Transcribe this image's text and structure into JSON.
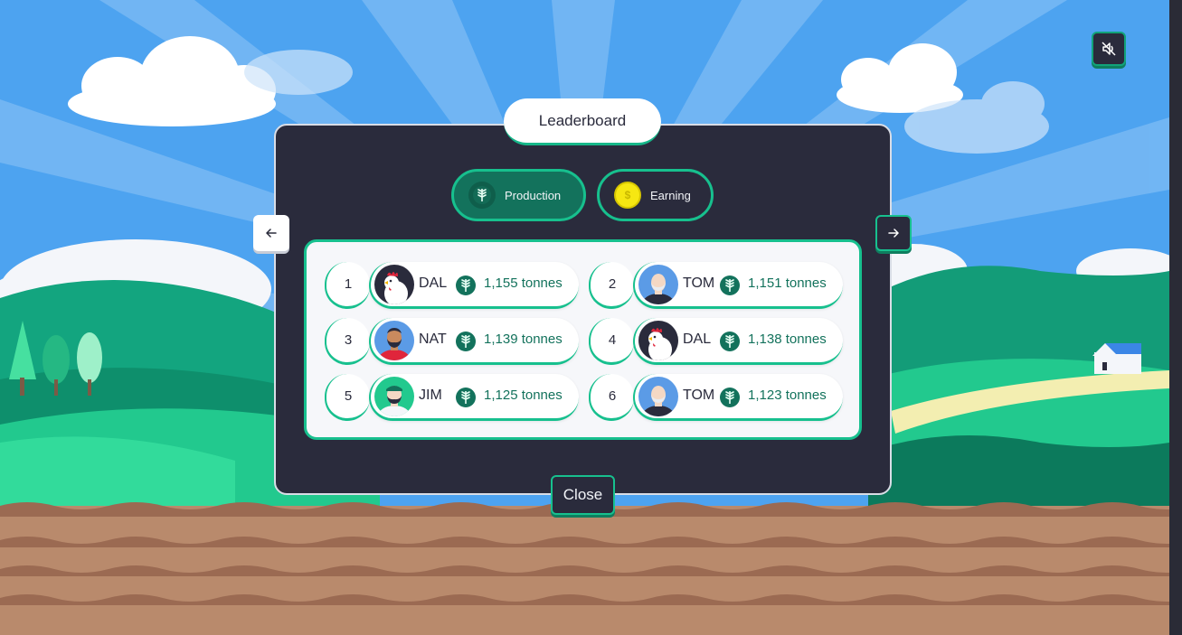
{
  "header": {
    "title": "Leaderboard"
  },
  "tabs": [
    {
      "label": "Production",
      "icon": "wheat-icon",
      "active": true
    },
    {
      "label": "Earning",
      "icon": "coin-icon",
      "active": false
    }
  ],
  "close_label": "Close",
  "entries": [
    {
      "rank": "1",
      "name": "DAL",
      "score": "1,155 tonnes",
      "avatar": "rooster-avatar"
    },
    {
      "rank": "2",
      "name": "TOM",
      "score": "1,151 tonnes",
      "avatar": "bald-man-avatar"
    },
    {
      "rank": "3",
      "name": "NAT",
      "score": "1,139 tonnes",
      "avatar": "bearded-man-avatar"
    },
    {
      "rank": "4",
      "name": "DAL",
      "score": "1,138 tonnes",
      "avatar": "rooster-avatar"
    },
    {
      "rank": "5",
      "name": "JIM",
      "score": "1,125 tonnes",
      "avatar": "farmer-avatar"
    },
    {
      "rank": "6",
      "name": "TOM",
      "score": "1,123 tonnes",
      "avatar": "bald-man-avatar"
    }
  ],
  "colors": {
    "panel": "#2a2b3c",
    "accent": "#17c08e",
    "accent_dark": "#13725c",
    "sky": "#4da3f0",
    "soil": "#b98a6c",
    "coin": "#f6e712"
  }
}
